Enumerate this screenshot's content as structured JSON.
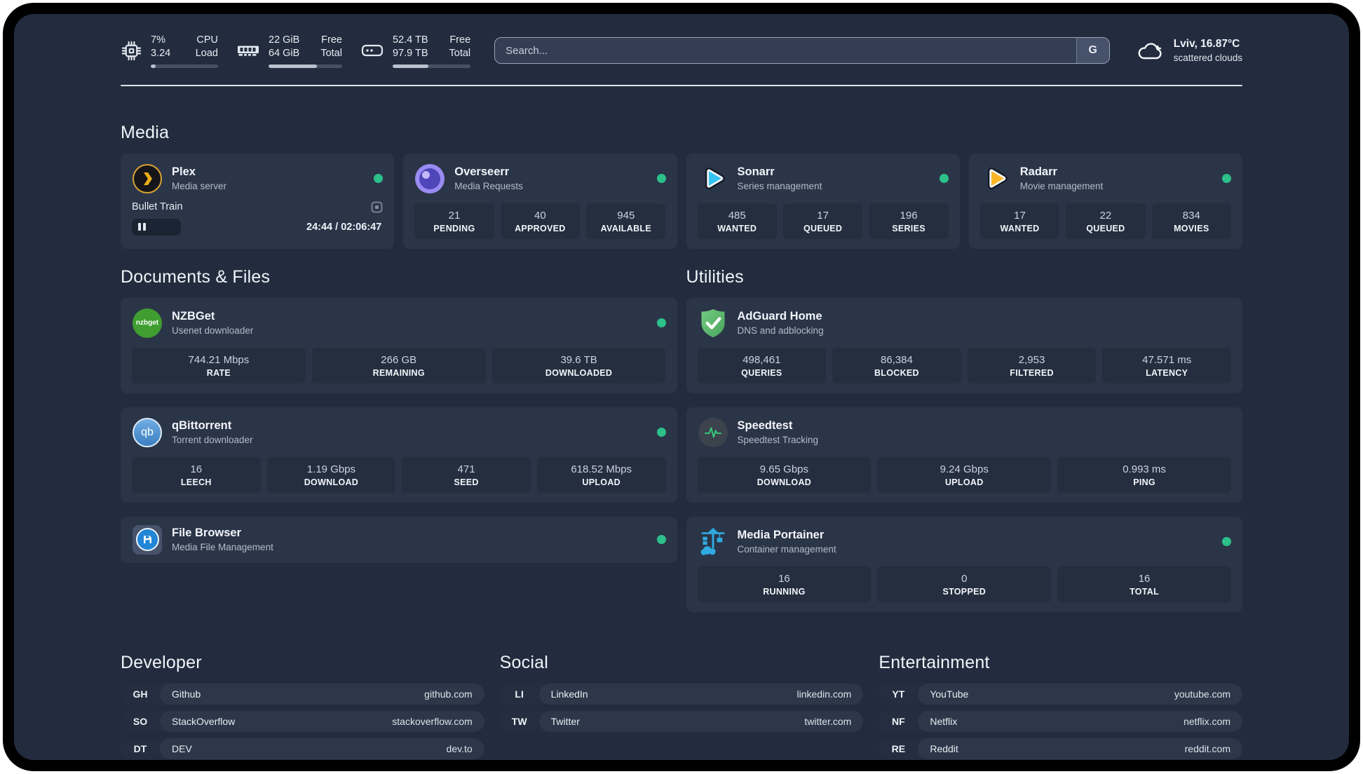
{
  "colors": {
    "status_online": "#2cc08a",
    "board_background": "#222c3e",
    "card_background": "#2b3548"
  },
  "header": {
    "system_stats": [
      {
        "icon": "cpu-icon",
        "value_top": "7%",
        "value_bottom": "3.24",
        "label_top": "CPU",
        "label_bottom": "Load",
        "progress_pct": 7
      },
      {
        "icon": "memory-icon",
        "value_top": "22 GiB",
        "value_bottom": "64 GiB",
        "label_top": "Free",
        "label_bottom": "Total",
        "progress_pct": 66
      },
      {
        "icon": "storage-icon",
        "value_top": "52.4 TB",
        "value_bottom": "97.9 TB",
        "label_top": "Free",
        "label_bottom": "Total",
        "progress_pct": 46
      }
    ],
    "search": {
      "placeholder": "Search...",
      "engine_label": "G"
    },
    "weather": {
      "location_temperature": "Lviv, 16.87°C",
      "condition": "scattered clouds"
    }
  },
  "sections": {
    "media": {
      "title": "Media",
      "apps": [
        {
          "name": "Plex",
          "description": "Media server",
          "status": "online",
          "now_playing": {
            "title": "Bullet Train",
            "time_display": "24:44 / 02:06:47",
            "progress_pct": 19.5
          }
        },
        {
          "name": "Overseerr",
          "description": "Media Requests",
          "status": "online",
          "stats": [
            {
              "value": "21",
              "label": "PENDING"
            },
            {
              "value": "40",
              "label": "APPROVED"
            },
            {
              "value": "945",
              "label": "AVAILABLE"
            }
          ]
        },
        {
          "name": "Sonarr",
          "description": "Series management",
          "status": "online",
          "stats": [
            {
              "value": "485",
              "label": "WANTED"
            },
            {
              "value": "17",
              "label": "QUEUED"
            },
            {
              "value": "196",
              "label": "SERIES"
            }
          ]
        },
        {
          "name": "Radarr",
          "description": "Movie management",
          "status": "online",
          "stats": [
            {
              "value": "17",
              "label": "WANTED"
            },
            {
              "value": "22",
              "label": "QUEUED"
            },
            {
              "value": "834",
              "label": "MOVIES"
            }
          ]
        }
      ]
    },
    "documents": {
      "title": "Documents & Files",
      "apps": [
        {
          "name": "NZBGet",
          "description": "Usenet downloader",
          "status": "online",
          "stats": [
            {
              "value": "744.21 Mbps",
              "label": "RATE"
            },
            {
              "value": "266 GB",
              "label": "REMAINING"
            },
            {
              "value": "39.6 TB",
              "label": "DOWNLOADED"
            }
          ]
        },
        {
          "name": "qBittorrent",
          "description": "Torrent downloader",
          "status": "online",
          "stats": [
            {
              "value": "16",
              "label": "LEECH"
            },
            {
              "value": "1.19 Gbps",
              "label": "DOWNLOAD"
            },
            {
              "value": "471",
              "label": "SEED"
            },
            {
              "value": "618.52 Mbps",
              "label": "UPLOAD"
            }
          ]
        },
        {
          "name": "File Browser",
          "description": "Media File Management",
          "status": "online",
          "stats": []
        }
      ]
    },
    "utilities": {
      "title": "Utilities",
      "apps": [
        {
          "name": "AdGuard Home",
          "description": "DNS and adblocking",
          "stats": [
            {
              "value": "498,461",
              "label": "QUERIES"
            },
            {
              "value": "86,384",
              "label": "BLOCKED"
            },
            {
              "value": "2,953",
              "label": "FILTERED"
            },
            {
              "value": "47.571 ms",
              "label": "LATENCY"
            }
          ]
        },
        {
          "name": "Speedtest",
          "description": "Speedtest Tracking",
          "stats": [
            {
              "value": "9.65 Gbps",
              "label": "DOWNLOAD"
            },
            {
              "value": "9.24 Gbps",
              "label": "UPLOAD"
            },
            {
              "value": "0.993 ms",
              "label": "PING"
            }
          ]
        },
        {
          "name": "Media Portainer",
          "description": "Container management",
          "status": "online",
          "stats": [
            {
              "value": "16",
              "label": "RUNNING"
            },
            {
              "value": "0",
              "label": "STOPPED"
            },
            {
              "value": "16",
              "label": "TOTAL"
            }
          ]
        }
      ]
    },
    "developer": {
      "title": "Developer",
      "links": [
        {
          "tag": "GH",
          "name": "Github",
          "url": "github.com"
        },
        {
          "tag": "SO",
          "name": "StackOverflow",
          "url": "stackoverflow.com"
        },
        {
          "tag": "DT",
          "name": "DEV",
          "url": "dev.to"
        }
      ]
    },
    "social": {
      "title": "Social",
      "links": [
        {
          "tag": "LI",
          "name": "LinkedIn",
          "url": "linkedin.com"
        },
        {
          "tag": "TW",
          "name": "Twitter",
          "url": "twitter.com"
        }
      ]
    },
    "entertainment": {
      "title": "Entertainment",
      "links": [
        {
          "tag": "YT",
          "name": "YouTube",
          "url": "youtube.com"
        },
        {
          "tag": "NF",
          "name": "Netflix",
          "url": "netflix.com"
        },
        {
          "tag": "RE",
          "name": "Reddit",
          "url": "reddit.com"
        }
      ]
    }
  }
}
